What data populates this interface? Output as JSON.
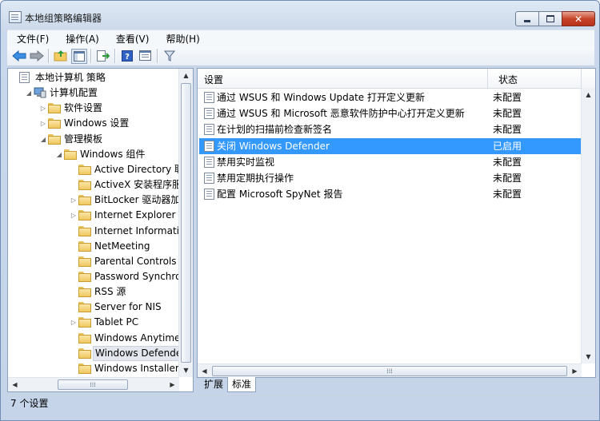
{
  "window": {
    "title": "本地组策略编辑器",
    "close_glyph": "✕"
  },
  "menu": [
    "文件(F)",
    "操作(A)",
    "查看(V)",
    "帮助(H)"
  ],
  "toolbar_icons": [
    "back-arrow-icon",
    "forward-arrow-icon",
    "up-folder-icon",
    "show-hide-tree-icon",
    "export-list-icon",
    "help-icon",
    "properties-icon",
    "filter-icon"
  ],
  "tree": [
    {
      "label": "本地计算机 策略",
      "level": 0,
      "icon": "policy",
      "expander": ""
    },
    {
      "label": "计算机配置",
      "level": 1,
      "icon": "computer",
      "expander": "◢"
    },
    {
      "label": "软件设置",
      "level": 2,
      "icon": "folder",
      "expander": "▷"
    },
    {
      "label": "Windows 设置",
      "level": 2,
      "icon": "folder",
      "expander": "▷"
    },
    {
      "label": "管理模板",
      "level": 2,
      "icon": "folder",
      "expander": "◢"
    },
    {
      "label": "Windows 组件",
      "level": 3,
      "icon": "folder",
      "expander": "◢"
    },
    {
      "label": "Active Directory 联合",
      "level": 4,
      "icon": "folder",
      "expander": ""
    },
    {
      "label": "ActiveX 安装程序服务",
      "level": 4,
      "icon": "folder",
      "expander": ""
    },
    {
      "label": "BitLocker 驱动器加密",
      "level": 4,
      "icon": "folder",
      "expander": "▷"
    },
    {
      "label": "Internet Explorer",
      "level": 4,
      "icon": "folder",
      "expander": "▷"
    },
    {
      "label": "Internet Information",
      "level": 4,
      "icon": "folder",
      "expander": ""
    },
    {
      "label": "NetMeeting",
      "level": 4,
      "icon": "folder",
      "expander": ""
    },
    {
      "label": "Parental Controls",
      "level": 4,
      "icon": "folder",
      "expander": ""
    },
    {
      "label": "Password Synchronizi",
      "level": 4,
      "icon": "folder",
      "expander": ""
    },
    {
      "label": "RSS 源",
      "level": 4,
      "icon": "folder",
      "expander": ""
    },
    {
      "label": "Server for NIS",
      "level": 4,
      "icon": "folder",
      "expander": ""
    },
    {
      "label": "Tablet PC",
      "level": 4,
      "icon": "folder",
      "expander": "▷"
    },
    {
      "label": "Windows Anytime Up",
      "level": 4,
      "icon": "folder",
      "expander": ""
    },
    {
      "label": "Windows Defender",
      "level": 4,
      "icon": "folder",
      "expander": "",
      "selected": true
    },
    {
      "label": "Windows Installer",
      "level": 4,
      "icon": "folder",
      "expander": ""
    }
  ],
  "list": {
    "col_setting": "设置",
    "col_state": "状态",
    "rows": [
      {
        "name": "通过 WSUS 和 Windows Update 打开定义更新",
        "state": "未配置"
      },
      {
        "name": "通过 WSUS 和 Microsoft 恶意软件防护中心打开定义更新",
        "state": "未配置"
      },
      {
        "name": "在计划的扫描前检查新签名",
        "state": "未配置"
      },
      {
        "name": "关闭 Windows Defender",
        "state": "已启用",
        "selected": true
      },
      {
        "name": "禁用实时监视",
        "state": "未配置"
      },
      {
        "name": "禁用定期执行操作",
        "state": "未配置"
      },
      {
        "name": "配置 Microsoft SpyNet 报告",
        "state": "未配置"
      }
    ]
  },
  "tabs": [
    "扩展",
    "标准"
  ],
  "active_tab": "标准",
  "status": "7 个设置",
  "scroll": {
    "up": "▲",
    "down": "▼",
    "left": "◀",
    "right": "▶",
    "grip": "⁞⁞⁞"
  }
}
